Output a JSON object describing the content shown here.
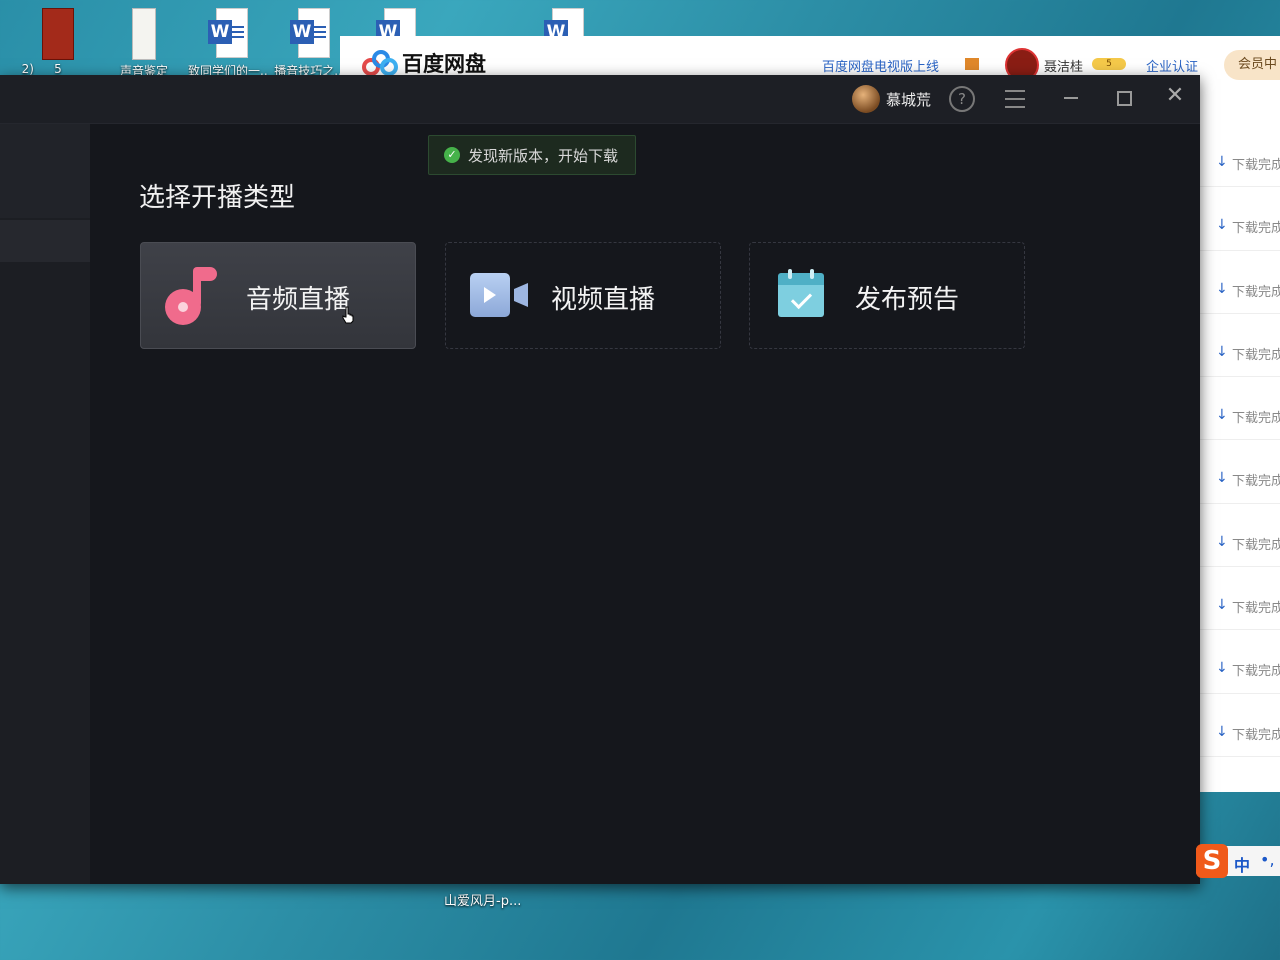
{
  "desktop": {
    "icons": [
      {
        "label": "2)"
      },
      {
        "label": "5"
      },
      {
        "label": "声音鉴定"
      },
      {
        "label": "致同学们的一..."
      },
      {
        "label": "播音技巧之..."
      }
    ],
    "bottom_label": "山爱风月-p..."
  },
  "baidu": {
    "title": "百度网盘",
    "tv_link": "百度网盘电视版上线",
    "username": "聂洁桂",
    "vip_badge": "5",
    "enterprise_link": "企业认证",
    "member_button": "会员中",
    "download_item_text": "下载完成",
    "download_items": [
      "下载完成",
      "下载完成",
      "下载完成",
      "下载完成",
      "下载完成",
      "下载完成",
      "下载完成",
      "下载完成",
      "下载完成",
      "下载完成"
    ]
  },
  "app": {
    "username": "慕城荒",
    "help_symbol": "?",
    "close_symbol": "✕",
    "toast": "发现新版本，开始下载",
    "toast_check": "✓",
    "section_title": "选择开播类型",
    "cards": [
      {
        "label": "音频直播",
        "icon": "music-note-icon",
        "active": true
      },
      {
        "label": "视频直播",
        "icon": "video-camera-icon",
        "active": false
      },
      {
        "label": "发布预告",
        "icon": "calendar-check-icon",
        "active": false
      }
    ]
  },
  "ime": {
    "logo": "S",
    "lang": "中",
    "punct": "•,"
  },
  "colors": {
    "accent_pink": "#f06b8c",
    "toast_green": "#46b24a",
    "app_bg": "#15171c"
  }
}
